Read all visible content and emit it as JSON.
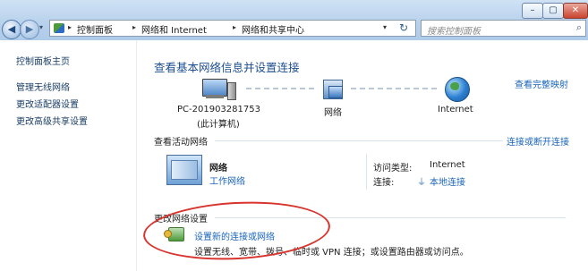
{
  "window": {
    "min_label": "–",
    "max_label": "▢",
    "close_label": "✕"
  },
  "nav": {
    "back_glyph": "◀",
    "forward_glyph": "▶",
    "dropdown_glyph": "▾"
  },
  "address": {
    "crumbs": [
      "控制面板",
      "网络和 Internet",
      "网络和共享中心"
    ],
    "separator": "▸",
    "dropdown_glyph": "▾",
    "refresh_glyph": "↻"
  },
  "search": {
    "placeholder": "搜索控制面板",
    "icon_glyph": "⌕"
  },
  "sidebar": {
    "home": "控制面板主页",
    "items": [
      "管理无线网络",
      "更改适配器设置",
      "更改高级共享设置"
    ]
  },
  "main": {
    "title": "查看基本网络信息并设置连接",
    "see_full_map": "查看完整映射",
    "map": {
      "pc_name": "PC-201903281753",
      "pc_sub": "(此计算机)",
      "network": "网络",
      "internet": "Internet"
    },
    "active": {
      "heading": "查看活动网络",
      "connect_link": "连接或断开连接",
      "network_name": "网络",
      "network_type": "工作网络",
      "access_type_label": "访问类型:",
      "access_type_value": "Internet",
      "connections_label": "连接:",
      "connections_value": "本地连接"
    },
    "change": {
      "heading": "更改网络设置",
      "setup_link": "设置新的连接或网络",
      "setup_desc": "设置无线、宽带、拨号、临时或 VPN 连接；或设置路由器或访问点。"
    }
  }
}
